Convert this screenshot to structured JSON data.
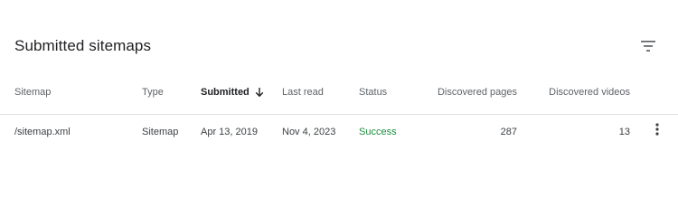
{
  "card": {
    "title": "Submitted sitemaps"
  },
  "icons": {
    "filter": "filter-list-icon",
    "sort": "arrow-downward-icon",
    "more": "more-vert-icon"
  },
  "colors": {
    "status_success": "#1e8e3e",
    "header_text": "#5f6368",
    "divider": "#e0e0e0"
  },
  "table": {
    "columns": [
      "Sitemap",
      "Type",
      "Submitted",
      "Last read",
      "Status",
      "Discovered pages",
      "Discovered videos"
    ],
    "sort": {
      "column": "Submitted",
      "direction": "descending"
    },
    "rows": [
      {
        "sitemap": "/sitemap.xml",
        "type": "Sitemap",
        "submitted": "Apr 13, 2019",
        "last_read": "Nov 4, 2023",
        "status": "Success",
        "discovered_pages": "287",
        "discovered_videos": "13"
      }
    ]
  }
}
